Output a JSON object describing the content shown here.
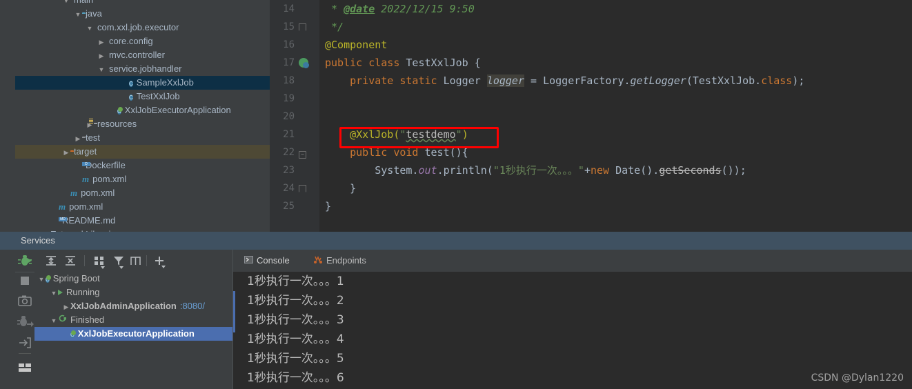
{
  "project_tree": {
    "rows": [
      {
        "indent": 4,
        "arrow": "down",
        "icon": "folder-icon",
        "label": "main",
        "cut_top": true
      },
      {
        "indent": 5,
        "arrow": "down",
        "icon": "folder-icon",
        "label": "java"
      },
      {
        "indent": 6,
        "arrow": "down",
        "icon": "package-icon",
        "label": "com.xxl.job.executor"
      },
      {
        "indent": 7,
        "arrow": "right",
        "icon": "package-icon",
        "label": "core.config"
      },
      {
        "indent": 7,
        "arrow": "right",
        "icon": "package-icon",
        "label": "mvc.controller"
      },
      {
        "indent": 7,
        "arrow": "down",
        "icon": "package-icon",
        "label": "service.jobhandler"
      },
      {
        "indent": 9,
        "arrow": "none",
        "icon": "class-icon",
        "label": "SampleXxlJob",
        "selected": true
      },
      {
        "indent": 9,
        "arrow": "none",
        "icon": "class-icon",
        "label": "TestXxlJob"
      },
      {
        "indent": 8,
        "arrow": "none",
        "icon": "spring-app-icon",
        "label": "XxlJobExecutorApplication"
      },
      {
        "indent": 6,
        "arrow": "right",
        "icon": "resources-folder-icon",
        "label": "resources"
      },
      {
        "indent": 5,
        "arrow": "right",
        "icon": "folder-icon-gray",
        "label": "test"
      },
      {
        "indent": 4,
        "arrow": "right",
        "icon": "folder-icon-orange",
        "label": "target",
        "highlighted": true
      },
      {
        "indent": 5,
        "arrow": "none",
        "icon": "docker-file-icon",
        "label": "Dockerfile"
      },
      {
        "indent": 5,
        "arrow": "none",
        "icon": "maven-icon",
        "label": "pom.xml"
      },
      {
        "indent": 4,
        "arrow": "none",
        "icon": "maven-icon",
        "label": "pom.xml"
      },
      {
        "indent": 3,
        "arrow": "none",
        "icon": "maven-icon",
        "label": "pom.xml"
      },
      {
        "indent": 3,
        "arrow": "none",
        "icon": "markdown-file-icon",
        "label": "README.md"
      },
      {
        "indent": 2,
        "arrow": "right",
        "icon": "library-icon",
        "label": "External Libraries",
        "cut_bottom": true
      }
    ]
  },
  "editor": {
    "lines": [
      {
        "num": "14",
        "gutter": "",
        "segments": [
          {
            "t": " * ",
            "c": "k-cmt"
          },
          {
            "t": "@date",
            "c": "k-cmt-a"
          },
          {
            "t": " 2022/12/15 9:50",
            "c": "k-cmt"
          }
        ]
      },
      {
        "num": "15",
        "gutter": "fold-end",
        "segments": [
          {
            "t": " */",
            "c": "k-cmt"
          }
        ]
      },
      {
        "num": "16",
        "gutter": "",
        "segments": [
          {
            "t": "@Component",
            "c": "k-ann"
          }
        ]
      },
      {
        "num": "17",
        "gutter": "run-icon",
        "segments": [
          {
            "t": "public class ",
            "c": "k-kw"
          },
          {
            "t": "TestXxlJob {",
            "c": "k-cls"
          }
        ]
      },
      {
        "num": "18",
        "gutter": "",
        "segments": [
          {
            "t": "    ",
            "c": "k-def"
          },
          {
            "t": "private static ",
            "c": "k-kw"
          },
          {
            "t": "Logger ",
            "c": "k-def"
          },
          {
            "t": "logger",
            "c": "k-static"
          },
          {
            "t": " = LoggerFactory.",
            "c": "k-def"
          },
          {
            "t": "getLogger",
            "c": "k-met"
          },
          {
            "t": "(TestXxlJob.",
            "c": "k-def"
          },
          {
            "t": "class",
            "c": "k-kw"
          },
          {
            "t": ");",
            "c": "k-def"
          }
        ]
      },
      {
        "num": "19",
        "gutter": "",
        "segments": []
      },
      {
        "num": "20",
        "gutter": "",
        "segments": []
      },
      {
        "num": "21",
        "gutter": "",
        "boxed": true,
        "segments": [
          {
            "t": "    ",
            "c": "k-def"
          },
          {
            "t": "@XxlJob(",
            "c": "k-ann"
          },
          {
            "t": "\"",
            "c": "k-str"
          },
          {
            "t": "testdemo",
            "c": "k-wavy"
          },
          {
            "t": "\"",
            "c": "k-str"
          },
          {
            "t": ")",
            "c": "k-ann"
          }
        ]
      },
      {
        "num": "22",
        "gutter": "fold-open",
        "segments": [
          {
            "t": "    ",
            "c": "k-def"
          },
          {
            "t": "public void ",
            "c": "k-kw"
          },
          {
            "t": "test(){",
            "c": "k-def"
          }
        ]
      },
      {
        "num": "23",
        "gutter": "",
        "segments": [
          {
            "t": "        ",
            "c": "k-def"
          },
          {
            "t": "System.",
            "c": "k-def"
          },
          {
            "t": "out",
            "c": "k-fld"
          },
          {
            "t": ".println(",
            "c": "k-def"
          },
          {
            "t": "\"1秒执行一次。。。\"",
            "c": "k-str"
          },
          {
            "t": "+",
            "c": "k-def"
          },
          {
            "t": "new ",
            "c": "k-kw"
          },
          {
            "t": "Date().",
            "c": "k-def"
          },
          {
            "t": "getSeconds",
            "c": "k-depr"
          },
          {
            "t": "());",
            "c": "k-def"
          }
        ]
      },
      {
        "num": "24",
        "gutter": "fold-end",
        "segments": [
          {
            "t": "    }",
            "c": "k-def"
          }
        ]
      },
      {
        "num": "25",
        "gutter": "",
        "segments": [
          {
            "t": "}",
            "c": "k-def"
          }
        ]
      }
    ]
  },
  "services": {
    "panel_title": "Services",
    "toolbar_icons": [
      "run-icon",
      "expand-all-icon",
      "collapse-all-icon",
      "group-by-icon",
      "filter-icon",
      "show-window-icon",
      "add-icon"
    ],
    "side_icons": [
      "debug-icon",
      "stop-icon",
      "camera-icon",
      "debugger-icon",
      "export-icon",
      "layout-icon"
    ],
    "tree": [
      {
        "indent": 0,
        "arrow": "down",
        "icon": "spring-boot-icon",
        "label": "Spring Boot"
      },
      {
        "indent": 1,
        "arrow": "down",
        "icon": "run-triangle-icon",
        "label": "Running"
      },
      {
        "indent": 2,
        "arrow": "right",
        "icon": "",
        "label": "XxlJobAdminApplication",
        "bold": true,
        "suffix": ":8080/"
      },
      {
        "indent": 1,
        "arrow": "down",
        "icon": "rerun-icon",
        "label": "Finished"
      },
      {
        "indent": 2,
        "arrow": "none",
        "icon": "spring-boot-icon",
        "label": "XxlJobExecutorApplication",
        "bold": true,
        "selected": true
      }
    ],
    "tabs": [
      {
        "label": "Console",
        "icon": "console-icon",
        "active": true
      },
      {
        "label": "Endpoints",
        "icon": "endpoints-icon",
        "active": false
      }
    ],
    "console_lines": [
      "1秒执行一次。。。1",
      "1秒执行一次。。。2",
      "1秒执行一次。。。3",
      "1秒执行一次。。。4",
      "1秒执行一次。。。5",
      "1秒执行一次。。。6"
    ]
  },
  "watermark": "CSDN @Dylan1220",
  "colors": {
    "editor_bg": "#2b2b2b",
    "panel_bg": "#3c3f41",
    "selection_blue": "#4b6eaf",
    "tree_selection": "#0d2f45",
    "highlight_olive": "#4e4935",
    "services_header": "#3f5161",
    "annotation_box": "#ff0000"
  }
}
